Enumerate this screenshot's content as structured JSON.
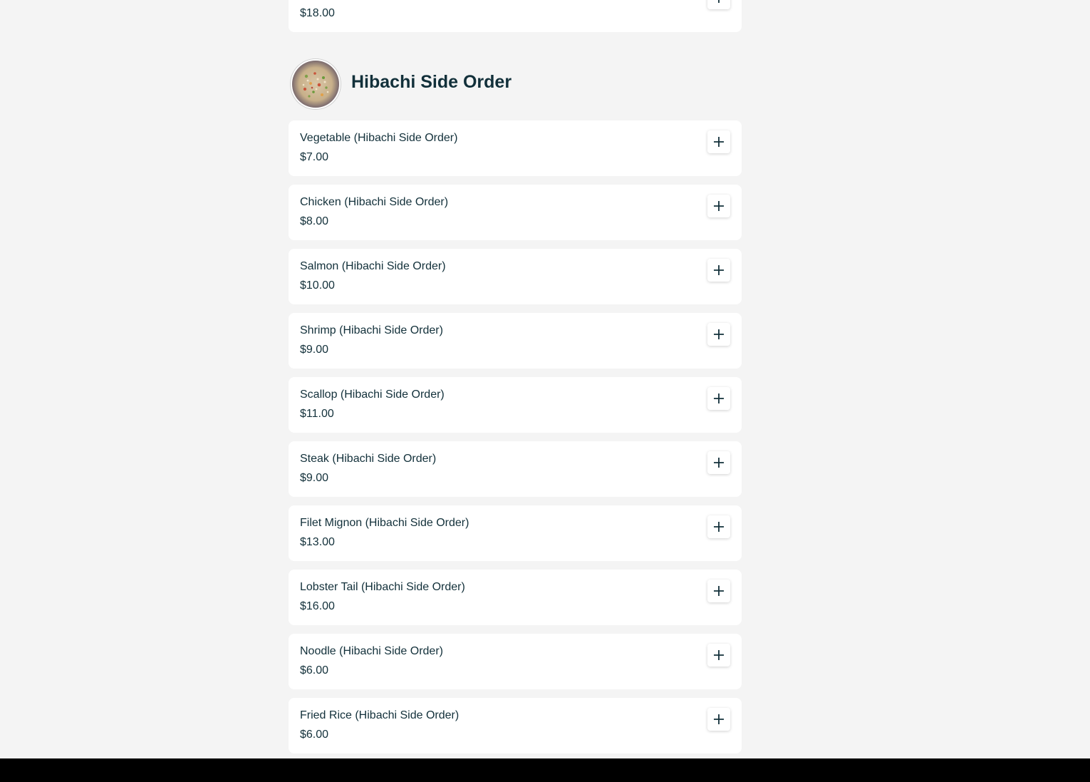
{
  "previous_item": {
    "price": "$18.00"
  },
  "category": {
    "title": "Hibachi Side Order",
    "thumbnail_icon": "fried-rice-photo"
  },
  "items": [
    {
      "name": "Vegetable (Hibachi Side Order)",
      "price": "$7.00"
    },
    {
      "name": "Chicken (Hibachi Side Order)",
      "price": "$8.00"
    },
    {
      "name": "Salmon (Hibachi Side Order)",
      "price": "$10.00"
    },
    {
      "name": "Shrimp (Hibachi Side Order)",
      "price": "$9.00"
    },
    {
      "name": "Scallop (Hibachi Side Order)",
      "price": "$11.00"
    },
    {
      "name": "Steak (Hibachi Side Order)",
      "price": "$9.00"
    },
    {
      "name": "Filet Mignon (Hibachi Side Order)",
      "price": "$13.00"
    },
    {
      "name": "Lobster Tail (Hibachi Side Order)",
      "price": "$16.00"
    },
    {
      "name": "Noodle (Hibachi Side Order)",
      "price": "$6.00"
    },
    {
      "name": "Fried Rice (Hibachi Side Order)",
      "price": "$6.00"
    }
  ],
  "add_button_icon": "plus-icon",
  "colors": {
    "background": "#f4f4f4",
    "card": "#ffffff",
    "text": "#12303a",
    "bottom_bar": "#000000"
  }
}
